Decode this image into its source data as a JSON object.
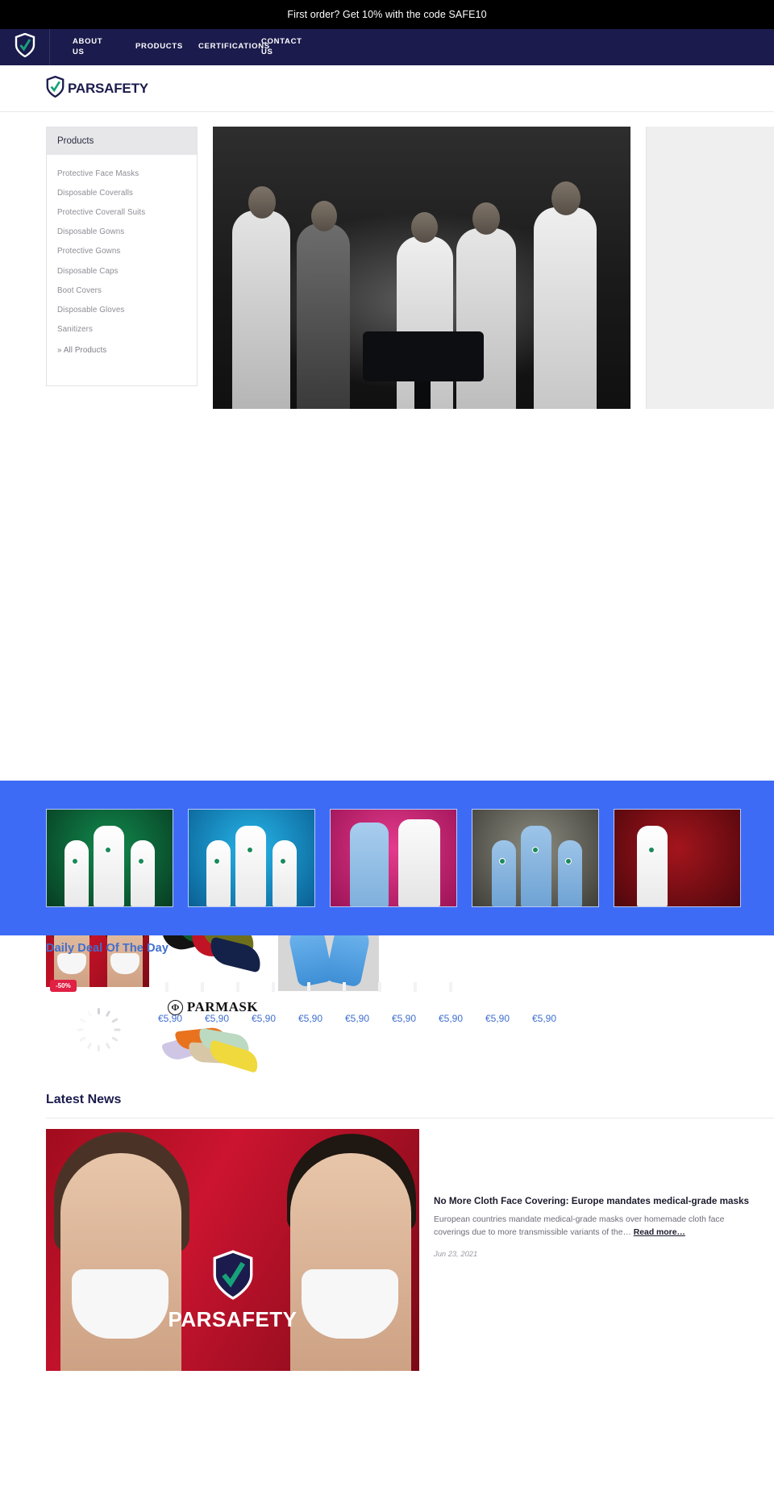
{
  "announcement": {
    "text": "First order? Get 10% with the code SAFE10"
  },
  "topnav": {
    "brand_icon": "shield-check-icon",
    "links": [
      {
        "label": "ABOUT US"
      },
      {
        "label": "PRODUCTS"
      },
      {
        "label": "CERTIFICATIONS"
      },
      {
        "label": "CONTACT US"
      }
    ]
  },
  "logobar": {
    "brand_icon": "shield-check-icon",
    "brand_text": "PARSAFETY"
  },
  "sidebar": {
    "header": "Products",
    "items": [
      {
        "label": "Protective Face Masks"
      },
      {
        "label": "Disposable Coveralls"
      },
      {
        "label": "Protective Coverall Suits"
      },
      {
        "label": "Disposable Gowns"
      },
      {
        "label": "Protective Gowns"
      },
      {
        "label": "Disposable Caps"
      },
      {
        "label": "Boot Covers"
      },
      {
        "label": "Disposable Gloves"
      },
      {
        "label": "Sanitizers"
      }
    ],
    "all_products": "» All Products"
  },
  "hero": {
    "slide_alt": "medical-staff-meeting-photo"
  },
  "product_tiles": [
    {
      "name": "protective-face-masks-tile"
    },
    {
      "name": "colored-masks-tile"
    },
    {
      "name": "disposable-gloves-tile"
    },
    {
      "name": "sanitizer-wipes-tile"
    },
    {
      "name": "pastel-masks-tile"
    }
  ],
  "parmask": {
    "glyph": "Φ",
    "word": "PARMASK"
  },
  "carousel": {
    "band_color": "#3d6bf5",
    "cards": [
      {
        "name": "coveralls-green",
        "bg_from": "#0a6b3d",
        "bg_to": "#0d4a2b"
      },
      {
        "name": "coveralls-blue",
        "bg_from": "#14a6e0",
        "bg_to": "#0b6fa8"
      },
      {
        "name": "gowns-pink",
        "bg_from": "#d6277a",
        "bg_to": "#a81a5c"
      },
      {
        "name": "gowns-gray",
        "bg_from": "#7d7d72",
        "bg_to": "#4a4a43"
      },
      {
        "name": "gowns-red",
        "bg_from": "#8f1118",
        "bg_to": "#5c0a10"
      }
    ]
  },
  "daily_deal": {
    "title": "Daily Deal Of The Day",
    "discount_badge": "-50%",
    "prices": [
      "€5,90",
      "€5,90",
      "€5,90",
      "€5,90",
      "€5,90",
      "€5,90",
      "€5,90",
      "€5,90",
      "€5,90"
    ],
    "accent_color": "#3f6fd0",
    "badge_color": "#e02044"
  },
  "latest_news": {
    "title": "Latest News",
    "article": {
      "headline": "No More Cloth Face Covering: Europe mandates medical-grade masks",
      "excerpt": "European countries mandate medical-grade masks over homemade cloth face coverings due to more transmissible variants of the…",
      "read_more": "Read more…",
      "date": "Jun 23, 2021",
      "thumb_brand": "PARSAFETY"
    }
  }
}
